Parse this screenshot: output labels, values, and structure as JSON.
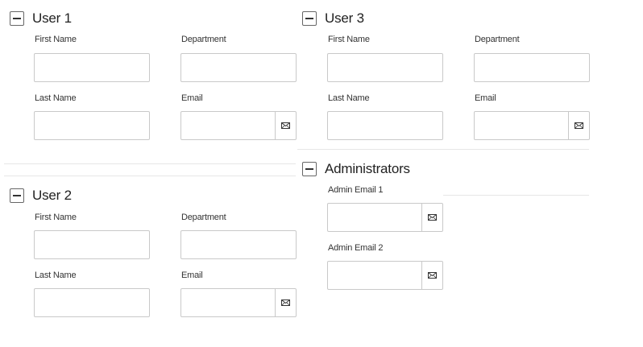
{
  "user1": {
    "title": "User 1",
    "first_name_label": "First Name",
    "first_name_value": "",
    "department_label": "Department",
    "department_value": "",
    "last_name_label": "Last Name",
    "last_name_value": "",
    "email_label": "Email",
    "email_value": ""
  },
  "user2": {
    "title": "User 2",
    "first_name_label": "First Name",
    "first_name_value": "",
    "department_label": "Department",
    "department_value": "",
    "last_name_label": "Last Name",
    "last_name_value": "",
    "email_label": "Email",
    "email_value": ""
  },
  "user3": {
    "title": "User 3",
    "first_name_label": "First Name",
    "first_name_value": "",
    "department_label": "Department",
    "department_value": "",
    "last_name_label": "Last Name",
    "last_name_value": "",
    "email_label": "Email",
    "email_value": ""
  },
  "administrators": {
    "title": "Administrators",
    "admin_email_1_label": "Admin Email 1",
    "admin_email_1_value": "",
    "admin_email_2_label": "Admin Email 2",
    "admin_email_2_value": ""
  },
  "icons": {
    "collapse": "minus-square-icon",
    "email": "envelope-icon"
  }
}
